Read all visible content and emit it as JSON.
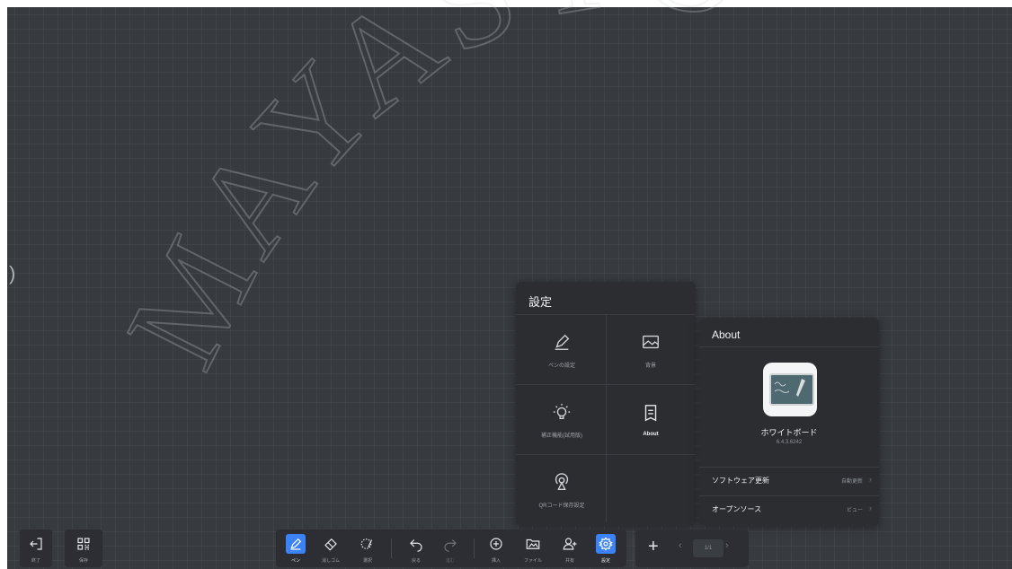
{
  "watermark": "MAYASYO",
  "settings": {
    "title": "設定",
    "items": [
      {
        "label": "ペンの設定",
        "icon": "pen-settings-icon"
      },
      {
        "label": "背景",
        "icon": "background-image-icon"
      },
      {
        "label": "補正機能(試用版)",
        "icon": "lightbulb-icon"
      },
      {
        "label": "About",
        "icon": "document-icon"
      },
      {
        "label": "QRコード保存設定",
        "icon": "qr-broadcast-icon"
      }
    ]
  },
  "about": {
    "title": "About",
    "app_name": "ホワイトボード",
    "version": "6.4.3.6242",
    "rows": [
      {
        "label": "ソフトウェア更新",
        "value": "自動更新"
      },
      {
        "label": "オープンソース",
        "value": "ビュー"
      }
    ]
  },
  "toolbar_left": [
    {
      "label": "終了",
      "icon": "exit-icon"
    },
    {
      "label": "保存",
      "icon": "save-grid-icon"
    }
  ],
  "toolbar_main": [
    {
      "label": "ペン",
      "icon": "pen-icon"
    },
    {
      "label": "消しゴム",
      "icon": "eraser-icon"
    },
    {
      "label": "選択",
      "icon": "lasso-select-icon"
    },
    {
      "label": "戻る",
      "icon": "undo-icon"
    },
    {
      "label": "進む",
      "icon": "redo-icon"
    },
    {
      "label": "挿入",
      "icon": "insert-icon"
    },
    {
      "label": "ファイル",
      "icon": "file-folder-icon"
    },
    {
      "label": "共有",
      "icon": "share-user-icon"
    },
    {
      "label": "設定",
      "icon": "settings-gear-icon"
    }
  ],
  "page_nav": {
    "indicator": "1/1"
  },
  "colors": {
    "accent": "#3b82f6",
    "canvas": "#373a3f",
    "panel": "#2b2d31"
  }
}
